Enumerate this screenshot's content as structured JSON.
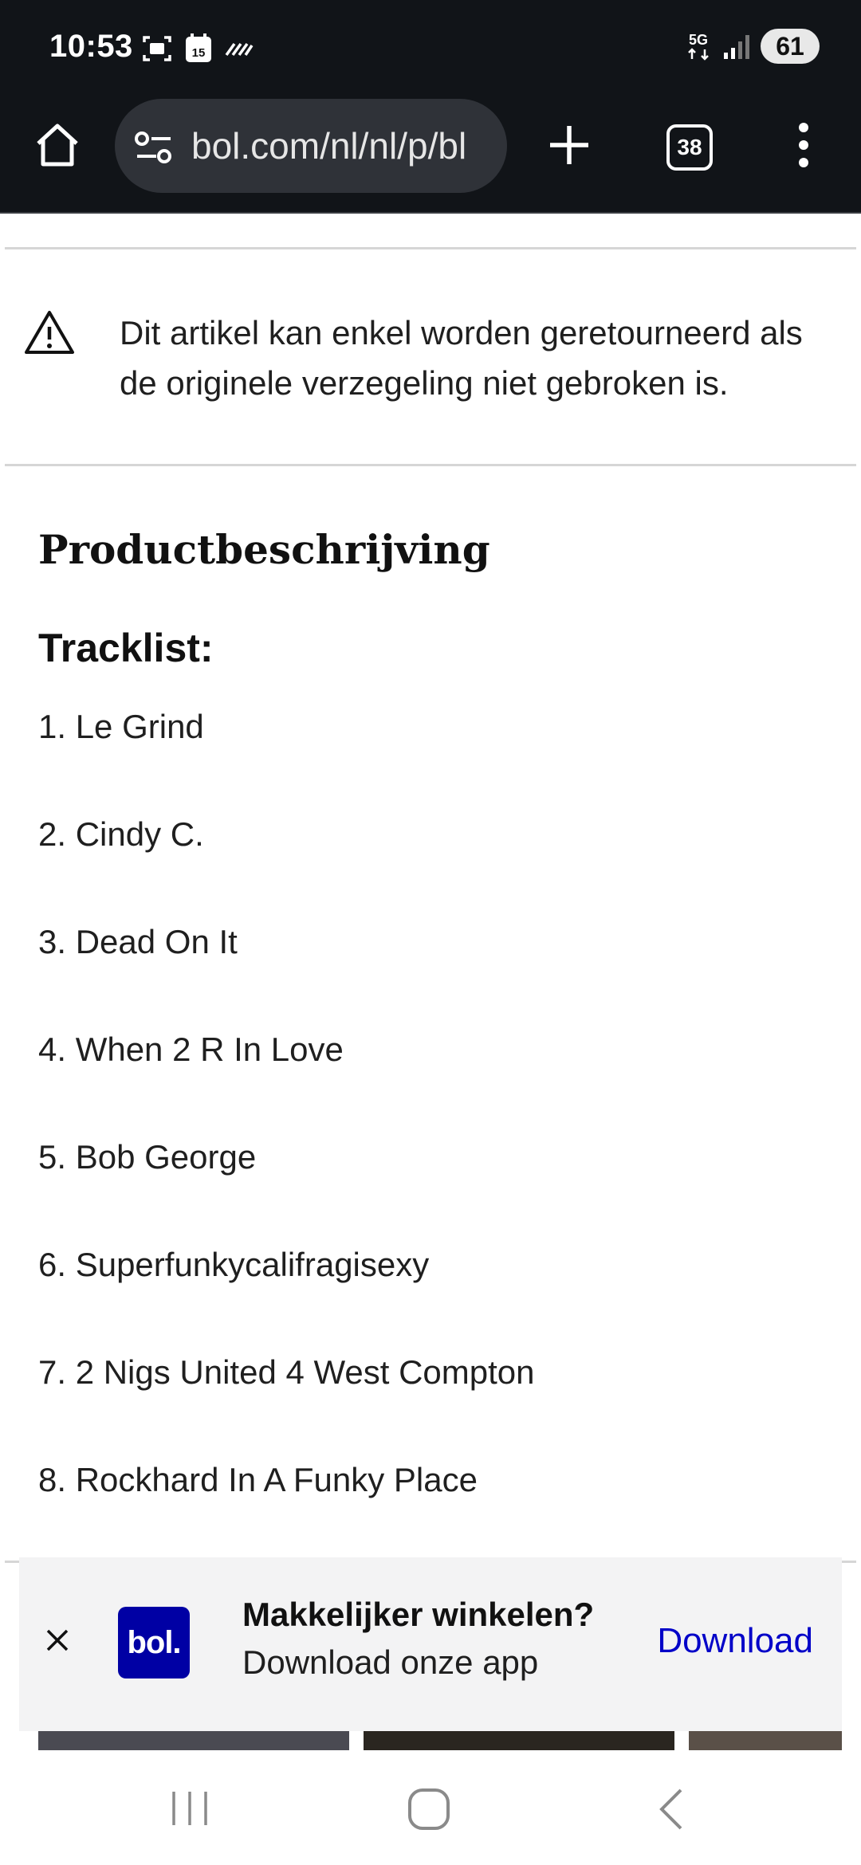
{
  "status_bar": {
    "time": "10:53",
    "calendar_day": "15",
    "network": "5G",
    "battery": "61"
  },
  "browser": {
    "url": "bol.com/nl/nl/p/bl",
    "tab_count": "38"
  },
  "notice": {
    "icon": "warning-icon",
    "text": "Dit artikel kan enkel worden geretourneerd als de originele verzegeling niet gebroken is."
  },
  "product": {
    "heading": "Productbeschrijving",
    "tracklist_heading": "Tracklist:",
    "tracks": [
      "1. Le Grind",
      "2. Cindy C.",
      "3. Dead On It",
      "4. When 2 R In Love",
      "5. Bob George",
      "6. Superfunkycalifragisexy",
      "7. 2 Nigs United 4 West Compton",
      "8. Rockhard In A Funky Place"
    ]
  },
  "app_banner": {
    "logo_text": "bol.",
    "title": "Makkelijker winkelen?",
    "subtitle": "Download onze app",
    "action": "Download",
    "brand_color": "#0000a4",
    "link_color": "#0000c8"
  }
}
